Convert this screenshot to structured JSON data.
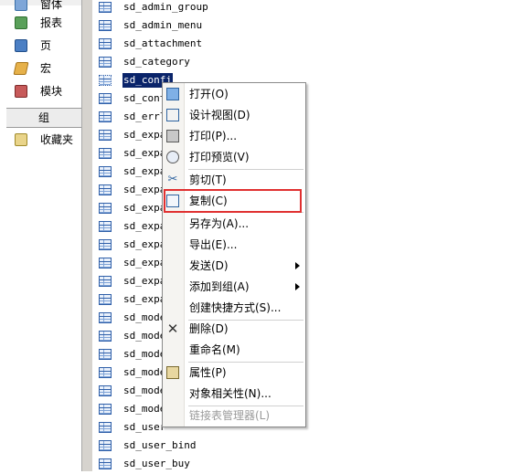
{
  "nav": {
    "items": [
      {
        "label": "窗体",
        "icon": "forms-icon"
      },
      {
        "label": "报表",
        "icon": "report-icon"
      },
      {
        "label": "页",
        "icon": "page-icon"
      },
      {
        "label": "宏",
        "icon": "macro-icon"
      },
      {
        "label": "模块",
        "icon": "module-icon"
      }
    ],
    "groups_label": "组",
    "favorites_label": "收藏夹"
  },
  "tables": [
    "sd_admin_group",
    "sd_admin_menu",
    "sd_attachment",
    "sd_category",
    "sd_config",
    "sd_cont",
    "sd_errl",
    "sd_expa",
    "sd_expa",
    "sd_expa",
    "sd_expa",
    "sd_expa",
    "sd_expa",
    "sd_expa",
    "sd_expa",
    "sd_expa",
    "sd_expa",
    "sd_mode",
    "sd_mode",
    "sd_mode",
    "sd_mode",
    "sd_mode",
    "sd_mode",
    "sd_user",
    "sd_user_bind",
    "sd_user_buy"
  ],
  "selected_table_index": 4,
  "selected_table_visible": "sd_confi",
  "context_menu": {
    "items": [
      {
        "label": "打开(O)",
        "icon": "open-icon"
      },
      {
        "label": "设计视图(D)",
        "icon": "design-view-icon"
      },
      {
        "label": "打印(P)...",
        "icon": "print-icon"
      },
      {
        "label": "打印预览(V)",
        "icon": "print-preview-icon"
      },
      {
        "label": "剪切(T)",
        "icon": "cut-icon"
      },
      {
        "label": "复制(C)",
        "icon": "copy-icon"
      },
      {
        "label": "另存为(A)...",
        "icon": ""
      },
      {
        "label": "导出(E)...",
        "icon": ""
      },
      {
        "label": "发送(D)",
        "icon": ""
      },
      {
        "label": "添加到组(A)",
        "icon": ""
      },
      {
        "label": "创建快捷方式(S)...",
        "icon": ""
      },
      {
        "label": "删除(D)",
        "icon": "delete-icon"
      },
      {
        "label": "重命名(M)",
        "icon": ""
      },
      {
        "label": "属性(P)",
        "icon": "properties-icon"
      },
      {
        "label": "对象相关性(N)...",
        "icon": ""
      },
      {
        "label": "链接表管理器(L)",
        "icon": ""
      }
    ],
    "highlighted": "复制(C)"
  },
  "colors": {
    "selection": "#0a246a",
    "highlight_box": "#e03030"
  }
}
